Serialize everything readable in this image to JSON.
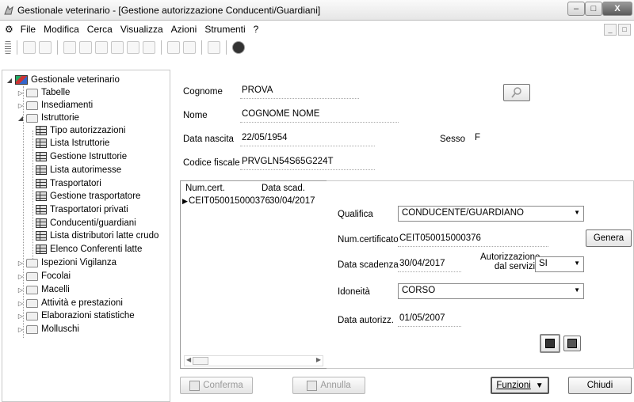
{
  "window": {
    "title": "Gestionale veterinario - [Gestione autorizzazione Conducenti/Guardiani]",
    "min": "–",
    "max": "□",
    "close": "X"
  },
  "menu": {
    "items": [
      "File",
      "Modifica",
      "Cerca",
      "Visualizza",
      "Azioni",
      "Strumenti",
      "?"
    ],
    "mdi_min": "_",
    "mdi_max": "□"
  },
  "tree": {
    "root": "Gestionale veterinario",
    "items": [
      {
        "label": "Tabelle"
      },
      {
        "label": "Insediamenti"
      },
      {
        "label": "Istruttorie"
      },
      {
        "label": "Tipo autorizzazioni"
      },
      {
        "label": "Lista Istruttorie"
      },
      {
        "label": "Gestione Istruttorie"
      },
      {
        "label": "Lista autorimesse"
      },
      {
        "label": "Trasportatori"
      },
      {
        "label": "Gestione trasportatore"
      },
      {
        "label": "Trasportatori privati"
      },
      {
        "label": "Conducenti/guardiani"
      },
      {
        "label": "Lista distributori latte crudo"
      },
      {
        "label": "Elenco Conferenti latte"
      },
      {
        "label": "Ispezioni Vigilanza"
      },
      {
        "label": "Focolai"
      },
      {
        "label": "Macelli"
      },
      {
        "label": "Attività e prestazioni"
      },
      {
        "label": "Elaborazioni statistiche"
      },
      {
        "label": "Molluschi"
      }
    ]
  },
  "person": {
    "cognome_label": "Cognome",
    "cognome": "PROVA",
    "nome_label": "Nome",
    "nome": "COGNOME NOME",
    "nascita_label": "Data nascita",
    "nascita": "22/05/1954",
    "sesso_label": "Sesso",
    "sesso": "F",
    "cf_label": "Codice fiscale",
    "cf": "PRVGLN54S65G224T"
  },
  "cert_list": {
    "headers": [
      "Num.cert.",
      "Data scad."
    ],
    "rows": [
      {
        "num": "CEIT050015000376",
        "scad": "30/04/2017"
      }
    ],
    "row_marker": "▶"
  },
  "detail": {
    "qualifica_label": "Qualifica",
    "qualifica": "CONDUCENTE/GUARDIANO",
    "numcert_label": "Num.certificato",
    "numcert": "CEIT050015000376",
    "genera": "Genera",
    "scadenza_label": "Data scadenza",
    "scadenza": "30/04/2017",
    "autorizzazione_label_1": "Autorizzazione",
    "autorizzazione_label_2": "dal servizio",
    "autorizzazione": "SI",
    "idoneita_label": "Idoneità",
    "idoneita": "CORSO",
    "data_aut_label": "Data autorizz.",
    "data_aut": "01/05/2007"
  },
  "footer": {
    "conferma": "Conferma",
    "annulla": "Annulla",
    "funzioni": "Funzioni",
    "chiudi": "Chiudi"
  }
}
